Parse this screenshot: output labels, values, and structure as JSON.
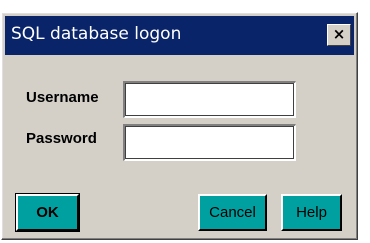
{
  "window": {
    "title": "SQL database logon",
    "close_glyph": "×"
  },
  "form": {
    "username_label": "Username",
    "username_value": "",
    "password_label": "Password",
    "password_value": ""
  },
  "buttons": {
    "ok": "OK",
    "cancel": "Cancel",
    "help": "Help"
  },
  "colors": {
    "titlebar": "#0a246a",
    "button_face": "#00a0a0",
    "dialog_bg": "#d4d0c8"
  }
}
